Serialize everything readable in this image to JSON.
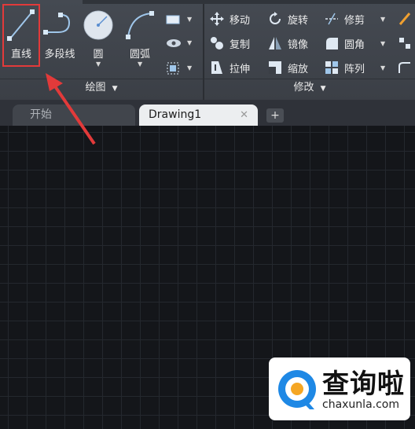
{
  "draw_panel": {
    "title": "绘图",
    "line_label": "直线",
    "polyline_label": "多段线",
    "circle_label": "圆",
    "arc_label": "圆弧"
  },
  "modify_panel": {
    "title": "修改",
    "move": "移动",
    "rotate": "旋转",
    "trim": "修剪",
    "copy": "复制",
    "mirror": "镜像",
    "fillet": "圆角",
    "stretch": "拉伸",
    "scale": "缩放",
    "array": "阵列"
  },
  "tabs": {
    "start": "开始",
    "drawing": "Drawing1",
    "close": "✕",
    "add": "+"
  },
  "watermark": {
    "text": "查询啦",
    "url": "chaxunla.com"
  },
  "colors": {
    "highlight": "#e23a3a",
    "ribbon": "#3f434a",
    "canvas": "#14161a"
  }
}
